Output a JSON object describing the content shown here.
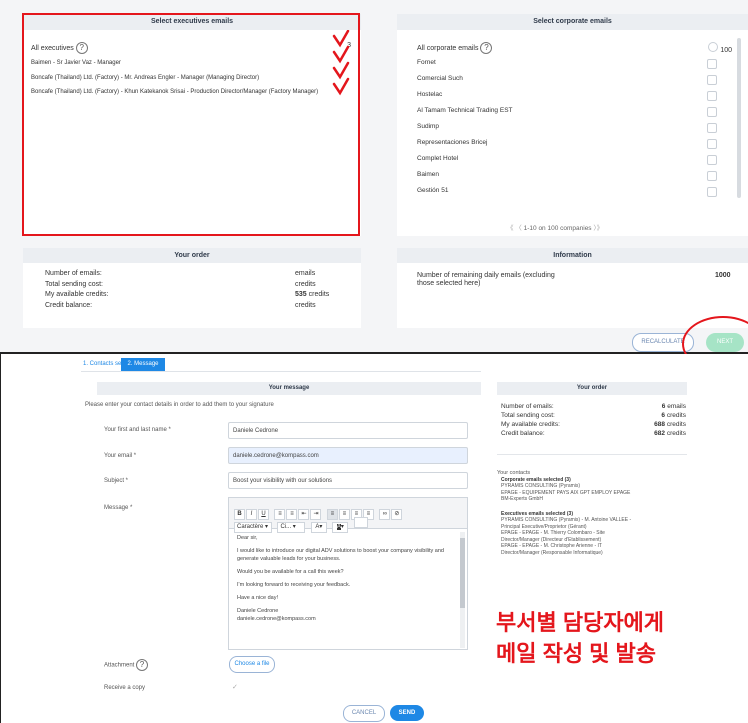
{
  "top": {
    "exec_panel": {
      "header": "Select executives emails",
      "all_label": "All executives",
      "all_count": "3",
      "items": [
        "Baimen - Sr Javier Vaz - Manager",
        "Boncafe (Thailand) Ltd. (Factory) - Mr. Andreas Engler - Manager (Managing Director)",
        "Boncafe (Thailand) Ltd. (Factory) - Khun Katekanok Srisai - Production Director/Manager (Factory Manager)"
      ]
    },
    "corp_panel": {
      "header": "Select corporate emails",
      "all_label": "All corporate emails",
      "all_count": "100",
      "items": [
        "Fornet",
        "Comercial Such",
        "Hostelac",
        "Al Tamam Technical Trading EST",
        "Sudimp",
        "Representaciones Bricej",
        "Complet Hotel",
        "Baimen",
        "Gestión 51"
      ],
      "pagination": {
        "prev": "《 〈",
        "text": "1-10 on 100 companies",
        "next": "〉》"
      }
    },
    "order": {
      "header": "Your order",
      "rows": [
        {
          "label": "Number of emails:",
          "value": "",
          "unit": "emails"
        },
        {
          "label": "Total sending cost:",
          "value": "",
          "unit": "credits"
        },
        {
          "label": "My available credits:",
          "value": "535",
          "unit": "credits"
        },
        {
          "label": "Credit balance:",
          "value": "",
          "unit": "credits"
        }
      ]
    },
    "info": {
      "header": "Information",
      "label": "Number of remaining daily emails (excluding those selected here)",
      "value": "1000"
    },
    "buttons": {
      "recalculate": "RECALCULATE",
      "next": "NEXT"
    }
  },
  "bottom": {
    "tabs": [
      "1. Contacts selection",
      "2. Message"
    ],
    "message_header": "Your message",
    "intro": "Please enter your contact details in order to add them to your signature",
    "fields": {
      "name_label": "Your first and last name *",
      "name_value": "Daniele Cedrone",
      "email_label": "Your email *",
      "email_value": "daniele.cedrone@kompass.com",
      "subject_label": "Subject *",
      "subject_value": "Boost your visibility with our solutions",
      "message_label": "Message *"
    },
    "toolbar": {
      "bold": "B",
      "italic": "I",
      "underline": "U",
      "font_select": "Caractère",
      "size_select": "Ci...",
      "font_color": "A",
      "bg_color": "A"
    },
    "message_lines": [
      "Dear sir,",
      "I would like to introduce our digital ADV solutions to boost your company visibility and generate valuable leads for your business.",
      "Would you be available for a call this week?",
      "I'm looking forward to receiving your feedback.",
      "Have a nice day!",
      "Daniele Cedrone",
      "daniele.cedrone@kompass.com"
    ],
    "attachment_label": "Attachment",
    "choose_file": "Choose a file",
    "copy_label": "Receive a copy",
    "cancel": "CANCEL",
    "send": "SEND",
    "order": {
      "header": "Your order",
      "rows": [
        {
          "label": "Number of emails:",
          "value": "6",
          "unit": "emails"
        },
        {
          "label": "Total sending cost:",
          "value": "6",
          "unit": "credits"
        },
        {
          "label": "My available credits:",
          "value": "688",
          "unit": "credits"
        },
        {
          "label": "Credit balance:",
          "value": "682",
          "unit": "credits"
        }
      ]
    },
    "contacts": {
      "title": "Your contacts",
      "corp_title": "Corporate emails selected (3)",
      "corp_items": [
        "PYRAMIS CONSULTING (Pyramis)",
        "EPAGE - EQUIPEMENT PAYS AIX GPT EMPLOY EPAGE",
        "BM-Experts GmbH"
      ],
      "exec_title": "Executives emails selected (3)",
      "exec_items": [
        "PYRAMIS CONSULTING (Pyramis) - M. Antoine VALLEE - Principal Executive/Proprietor (Gérant)",
        "EPAGE - EPAGE - M. Thierry Colombaro - Site Director/Manager (Directeur d'Etablissement)",
        "EPAGE - EPAGE - M. Christophe Arienne - IT Director/Manager (Responsable Informatique)"
      ]
    },
    "caption_line1": "부서별 담당자에게",
    "caption_line2": "메일 작성 및 발송"
  },
  "colors": {
    "accent": "#1e88e5",
    "annotation_red": "#e4161c",
    "next_green": "#a6e4c6",
    "panel_header": "#ebeef2"
  }
}
